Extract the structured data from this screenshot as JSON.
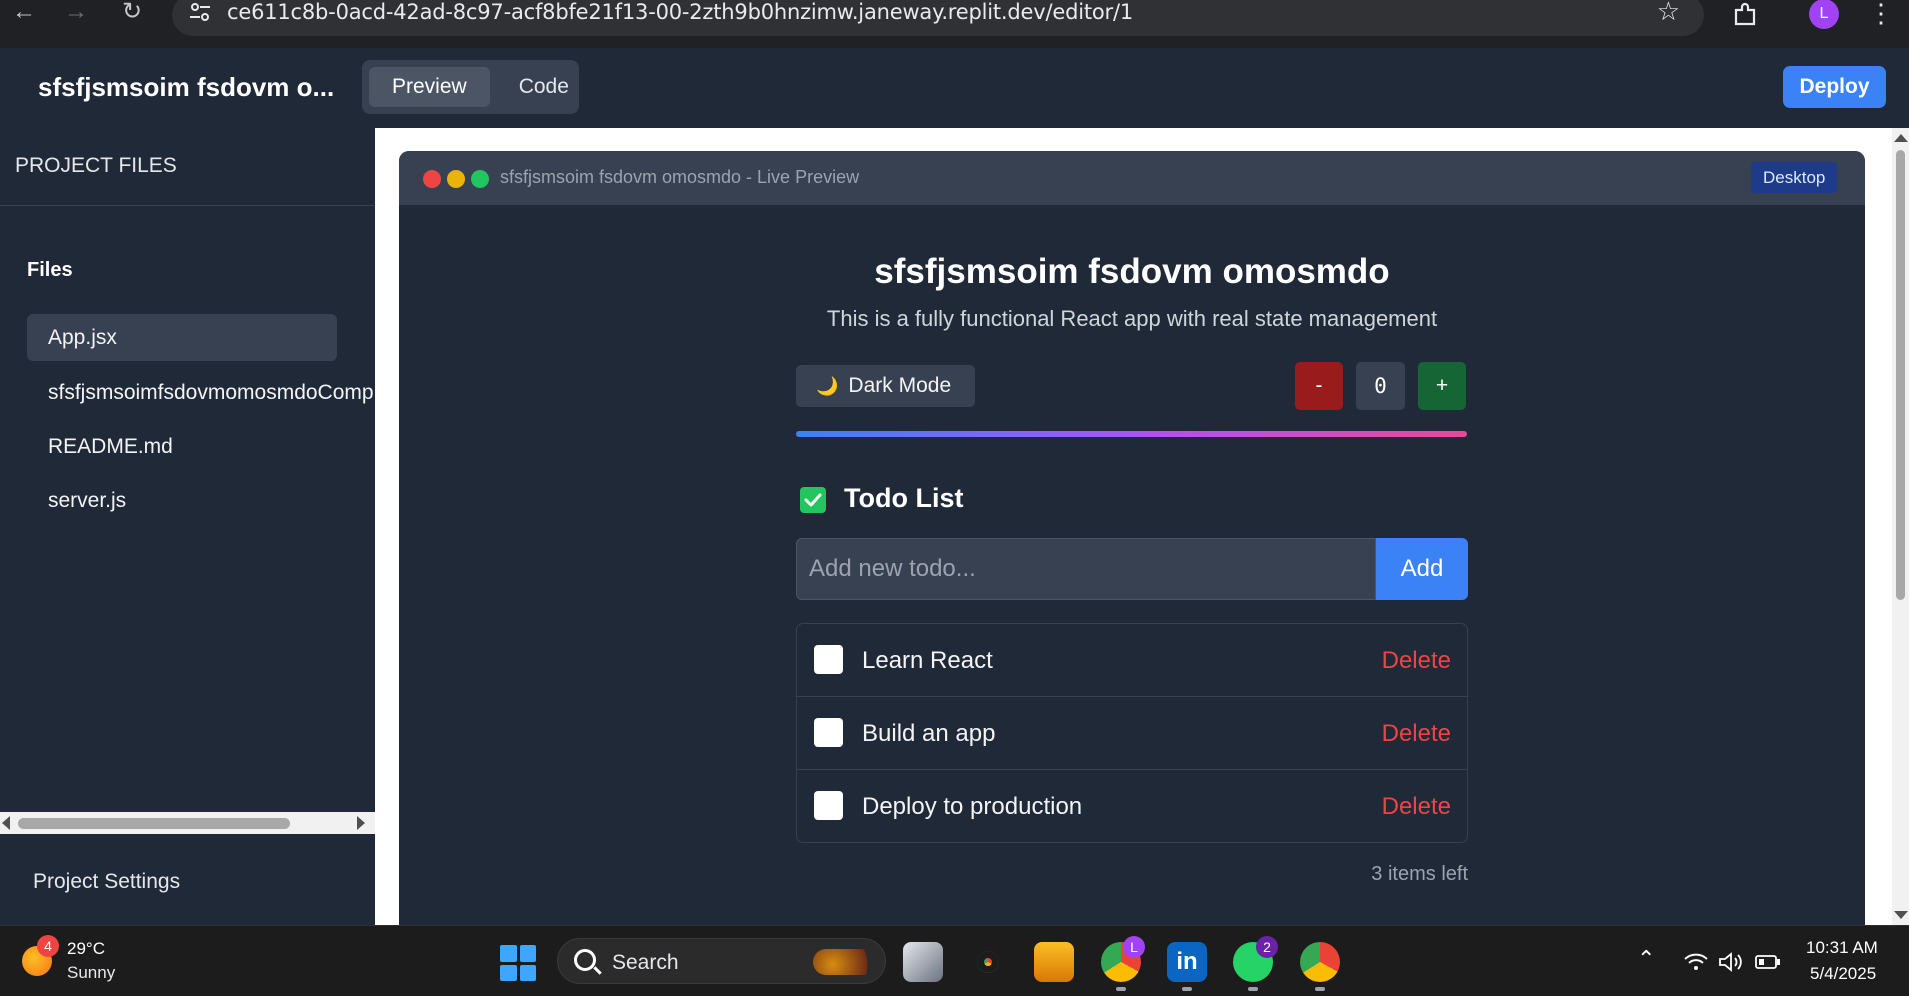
{
  "browser": {
    "url": "ce611c8b-0acd-42ad-8c97-acf8bfe21f13-00-2zth9b0hnzimw.janeway.replit.dev/editor/1",
    "profile_initial": "L"
  },
  "header": {
    "app_title": "sfsfjsmsoim fsdovm o...",
    "tabs": [
      {
        "label": "Preview",
        "active": true
      },
      {
        "label": "Code",
        "active": false
      }
    ],
    "deploy_label": "Deploy"
  },
  "sidebar": {
    "project_files_heading": "PROJECT FILES",
    "files_heading": "Files",
    "files": [
      {
        "name": "App.jsx",
        "active": true
      },
      {
        "name": "sfsfjsmsoimfsdovmomosmdoComp",
        "active": false
      },
      {
        "name": "README.md",
        "active": false
      },
      {
        "name": "server.js",
        "active": false
      }
    ],
    "settings_label": "Project Settings"
  },
  "preview": {
    "frame_title": "sfsfjsmsoim fsdovm omosmdo - Live Preview",
    "device_badge": "Desktop",
    "app": {
      "title": "sfsfjsmsoim fsdovm omosmdo",
      "subtitle": "This is a fully functional React app with real state management",
      "dark_mode_label": "Dark Mode",
      "moon_glyph": "🌙",
      "decrement_label": "-",
      "increment_label": "+",
      "counter_value": "0",
      "todo_heading": "Todo List",
      "todo_placeholder": "Add new todo...",
      "add_label": "Add",
      "todos": [
        {
          "text": "Learn React",
          "done": false,
          "delete_label": "Delete"
        },
        {
          "text": "Build an app",
          "done": false,
          "delete_label": "Delete"
        },
        {
          "text": "Deploy to production",
          "done": false,
          "delete_label": "Delete"
        }
      ],
      "items_left": "3 items left"
    }
  },
  "taskbar": {
    "weather_badge": "4",
    "weather_temp": "29°C",
    "weather_condition": "Sunny",
    "search_label": "Search",
    "chrome_profile_badge": "L",
    "whatsapp_badge": "2",
    "time": "10:31 AM",
    "date": "5/4/2025"
  },
  "colors": {
    "accent": "#3b82f6",
    "delete": "#ef4444",
    "success": "#22c55e",
    "decrement": "#991b1b",
    "increment": "#166534"
  }
}
